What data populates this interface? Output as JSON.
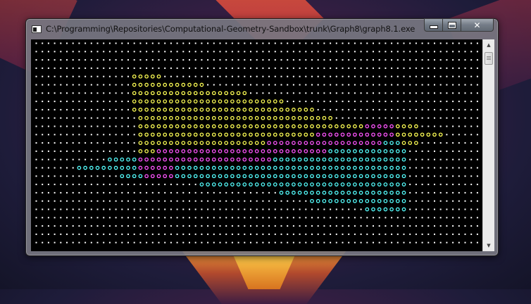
{
  "window": {
    "title": "C:\\Programming\\Repositories\\Computational-Geometry-Sandbox\\trunk\\Graph8\\graph8.1.exe",
    "icon": "console-app-icon",
    "buttons": {
      "minimize": "minimize-icon",
      "maximize": "maximize-icon",
      "close": "close-icon",
      "close_glyph": "✕"
    }
  },
  "console": {
    "background": "#000000",
    "columns": 73,
    "rows": 25,
    "glyph": "o",
    "empty_glyph": ".",
    "colors": {
      "background": "#ffffff",
      "region_a": "#ffff55",
      "region_b": "#ff55ff",
      "region_c": "#55ffff"
    },
    "runs": [
      [],
      [],
      [],
      [],
      [
        [
          "region_a",
          16,
          20
        ]
      ],
      [
        [
          "region_a",
          16,
          27
        ]
      ],
      [
        [
          "region_a",
          16,
          34
        ]
      ],
      [
        [
          "region_a",
          16,
          40
        ]
      ],
      [
        [
          "region_a",
          16,
          45
        ]
      ],
      [
        [
          "region_a",
          17,
          48
        ]
      ],
      [
        [
          "region_a",
          17,
          53
        ],
        [
          "region_b",
          54,
          58
        ],
        [
          "region_a",
          59,
          62
        ]
      ],
      [
        [
          "region_a",
          17,
          45
        ],
        [
          "region_b",
          46,
          58
        ],
        [
          "region_a",
          59,
          66
        ]
      ],
      [
        [
          "region_a",
          17,
          37
        ],
        [
          "region_b",
          38,
          56
        ],
        [
          "region_c",
          57,
          59
        ],
        [
          "region_a",
          60,
          62
        ]
      ],
      [
        [
          "region_a",
          17,
          19
        ],
        [
          "region_b",
          20,
          47
        ],
        [
          "region_c",
          48,
          60
        ]
      ],
      [
        [
          "region_c",
          12,
          16
        ],
        [
          "region_b",
          17,
          38
        ],
        [
          "region_c",
          39,
          60
        ]
      ],
      [
        [
          "region_c",
          7,
          16
        ],
        [
          "region_b",
          17,
          22
        ],
        [
          "region_c",
          23,
          60
        ]
      ],
      [
        [
          "region_c",
          14,
          17
        ],
        [
          "region_b",
          18,
          22
        ],
        [
          "region_c",
          23,
          60
        ]
      ],
      [
        [
          "region_c",
          27,
          60
        ]
      ],
      [
        [
          "region_c",
          40,
          60
        ]
      ],
      [
        [
          "region_c",
          45,
          60
        ]
      ],
      [
        [
          "region_c",
          54,
          60
        ]
      ],
      [],
      [],
      [],
      []
    ]
  },
  "scrollbar": {
    "up": "scroll-up-arrow",
    "down": "scroll-down-arrow",
    "up_glyph": "▲",
    "down_glyph": "▼"
  }
}
